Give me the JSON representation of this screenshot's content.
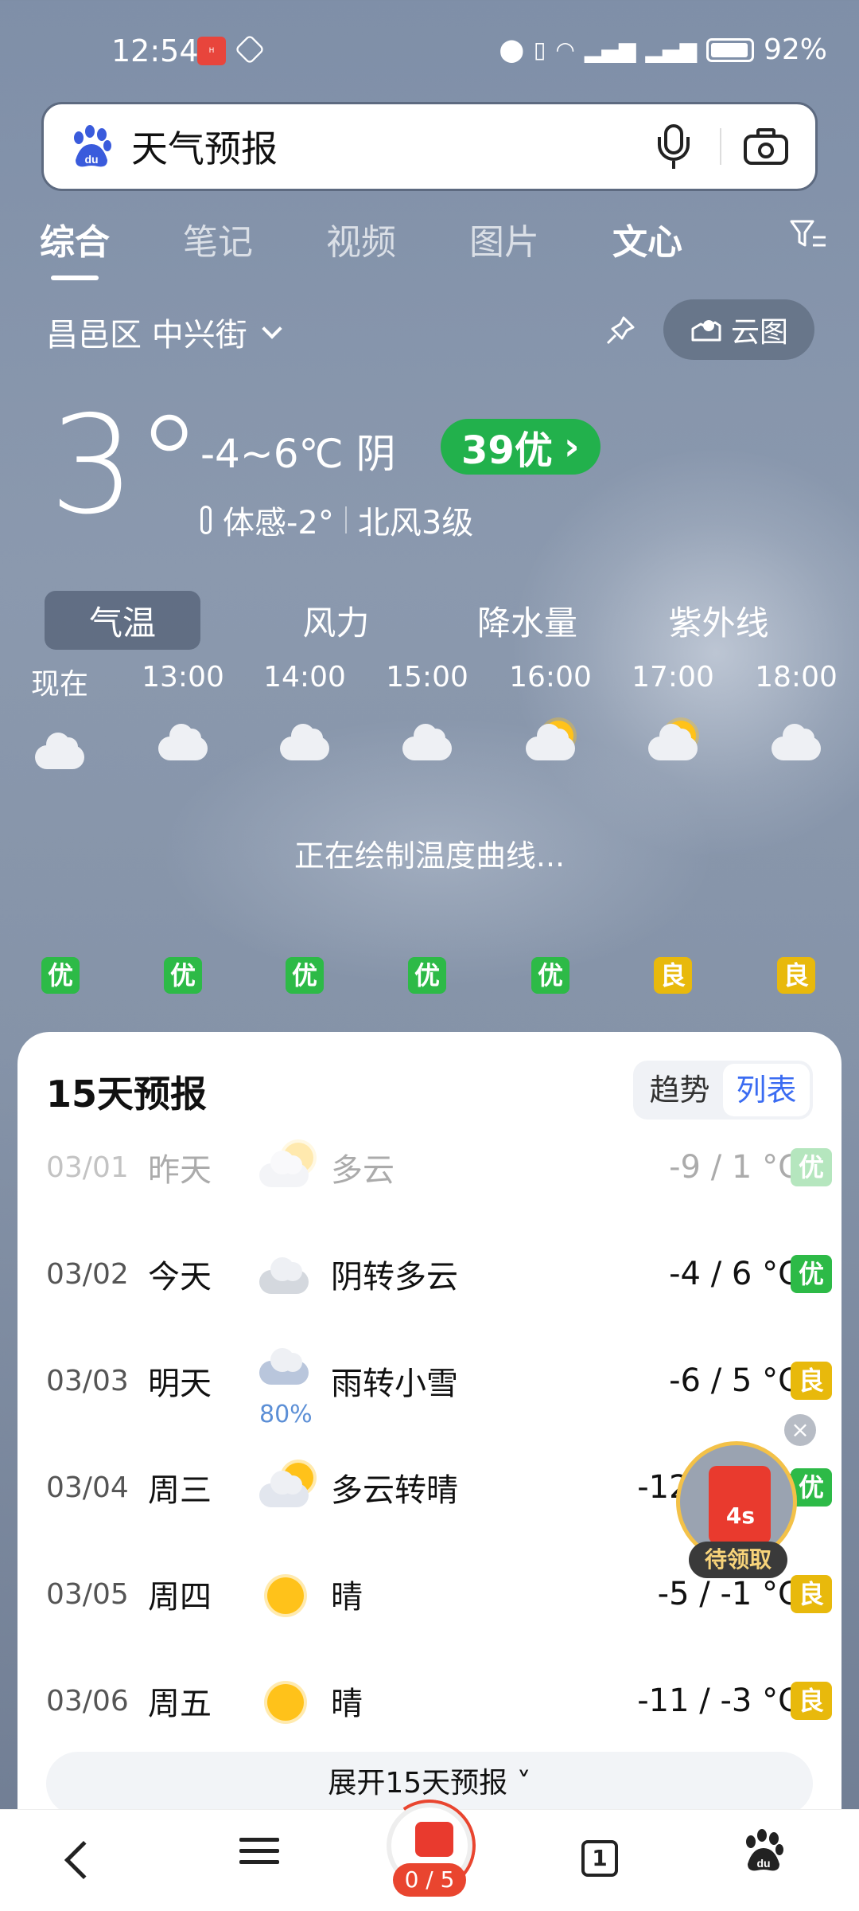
{
  "status": {
    "time": "12:54",
    "battery": "92%"
  },
  "search": {
    "query": "天气预报"
  },
  "tabs": [
    "综合",
    "笔记",
    "视频",
    "图片",
    "文心"
  ],
  "location": {
    "name": "昌邑区 中兴街",
    "cloud_map_label": "云图"
  },
  "current": {
    "temp": "3°",
    "range_desc": "-4~6℃  阴",
    "aqi": "39优",
    "feels_like": "体感-2°",
    "wind": "北风3级"
  },
  "segments": [
    "气温",
    "风力",
    "降水量",
    "紫外线"
  ],
  "hourly": [
    {
      "time": "现在",
      "icon": "cloudy-icon",
      "aq": "优"
    },
    {
      "time": "13:00",
      "icon": "cloudy-icon",
      "aq": "优"
    },
    {
      "time": "14:00",
      "icon": "cloudy-icon",
      "aq": "优"
    },
    {
      "time": "15:00",
      "icon": "cloudy-icon",
      "aq": "优"
    },
    {
      "time": "16:00",
      "icon": "partly-sunny-icon",
      "aq": "优"
    },
    {
      "time": "17:00",
      "icon": "partly-sunny-icon",
      "aq": "良"
    },
    {
      "time": "18:00",
      "icon": "moon-cloud-icon",
      "aq": "良"
    }
  ],
  "drawing_text": "正在绘制温度曲线...",
  "forecast": {
    "title": "15天预报",
    "toggle": [
      "趋势",
      "列表"
    ],
    "days": [
      {
        "date": "03/01",
        "day": "昨天",
        "desc": "多云",
        "temp": "-9 / 1 °C",
        "aq": "优",
        "icon": "partly-sunny-icon",
        "extra": ""
      },
      {
        "date": "03/02",
        "day": "今天",
        "desc": "阴转多云",
        "temp": "-4 / 6 °C",
        "aq": "优",
        "icon": "cloudy-icon",
        "extra": ""
      },
      {
        "date": "03/03",
        "day": "明天",
        "desc": "雨转小雪",
        "temp": "-6 / 5 °C",
        "aq": "良",
        "icon": "rain-icon",
        "extra": "80%"
      },
      {
        "date": "03/04",
        "day": "周三",
        "desc": "多云转晴",
        "temp": "-12 / -2 °C",
        "aq": "优",
        "icon": "partly-sunny-icon",
        "extra": ""
      },
      {
        "date": "03/05",
        "day": "周四",
        "desc": "晴",
        "temp": "-5 / -1 °C",
        "aq": "良",
        "icon": "sunny-icon",
        "extra": ""
      },
      {
        "date": "03/06",
        "day": "周五",
        "desc": "晴",
        "temp": "-11 / -3 °C",
        "aq": "良",
        "icon": "sunny-icon",
        "extra": ""
      }
    ],
    "expand_label": "展开15天预报"
  },
  "float": {
    "timer": "4s",
    "label": "待领取"
  },
  "bottom_nav": {
    "tab_count": "1",
    "progress": "0 / 5"
  },
  "colors": {
    "aq_good": "#2dba47",
    "aq_ok": "#e8b90c",
    "accent": "#3b6cf2"
  }
}
